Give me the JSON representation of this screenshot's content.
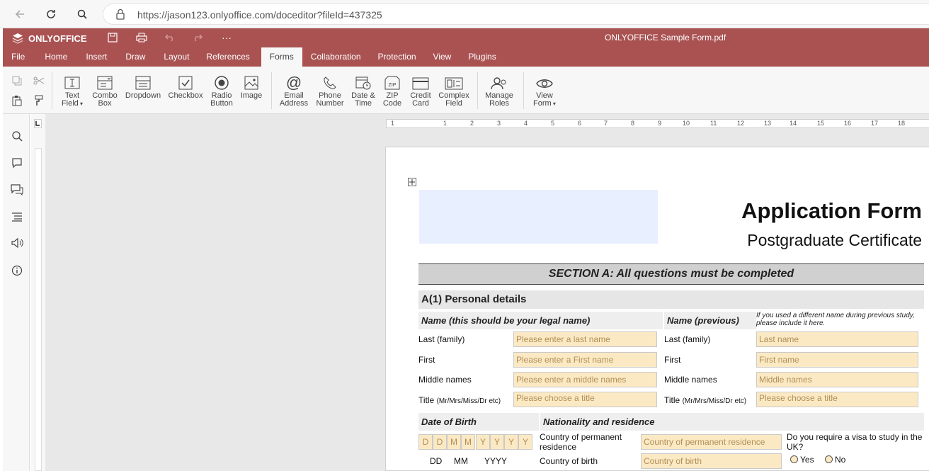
{
  "browser": {
    "url": "https://jason123.onlyoffice.com/doceditor?fileId=437325"
  },
  "app": {
    "logo_text": "ONLYOFFICE",
    "document_title": "ONLYOFFICE Sample Form.pdf",
    "brand_color": "#aa5252"
  },
  "tabs": [
    {
      "label": "File"
    },
    {
      "label": "Home"
    },
    {
      "label": "Insert"
    },
    {
      "label": "Draw"
    },
    {
      "label": "Layout"
    },
    {
      "label": "References"
    },
    {
      "label": "Forms"
    },
    {
      "label": "Collaboration"
    },
    {
      "label": "Protection"
    },
    {
      "label": "View"
    },
    {
      "label": "Plugins"
    }
  ],
  "active_tab": "Forms",
  "toolbar": {
    "text_field": [
      "Text",
      "Field"
    ],
    "combo_box": [
      "Combo",
      "Box"
    ],
    "dropdown": "Dropdown",
    "checkbox": "Checkbox",
    "radio_button": [
      "Radio",
      "Button"
    ],
    "image": "Image",
    "email_address": [
      "Email",
      "Address"
    ],
    "phone_number": [
      "Phone",
      "Number"
    ],
    "date_time": [
      "Date &",
      "Time"
    ],
    "zip_code": [
      "ZIP",
      "Code"
    ],
    "credit_card": [
      "Credit",
      "Card"
    ],
    "complex_field": [
      "Complex",
      "Field"
    ],
    "manage_roles": [
      "Manage",
      "Roles"
    ],
    "view_form": [
      "View",
      "Form"
    ]
  },
  "ruler": [
    "1",
    "1",
    "2",
    "3",
    "4",
    "5",
    "6",
    "7",
    "8",
    "9",
    "10",
    "11",
    "12",
    "13",
    "14",
    "15",
    "16",
    "17",
    "18"
  ],
  "document": {
    "heading": "Application Form",
    "subheading": "Postgraduate Certificate",
    "section_a": "SECTION A: All questions must be completed",
    "section_a1": "A(1) Personal details",
    "name_legal_header": "Name (this should be your legal name)",
    "name_previous_header": "Name (previous)",
    "name_previous_note": "If you used a different name during previous study, please include it here.",
    "left_fields": [
      {
        "label": "Last (family)",
        "placeholder": "Please enter a last name"
      },
      {
        "label": "First",
        "placeholder": "Please enter a First name"
      },
      {
        "label": "Middle names",
        "placeholder": "Please enter a middle names"
      },
      {
        "label": "Title",
        "label_small": "(Mr/Mrs/Miss/Dr etc)",
        "placeholder": "Please choose a title"
      }
    ],
    "right_fields": [
      {
        "label": "Last (family)",
        "placeholder": "Last name"
      },
      {
        "label": "First",
        "placeholder": "First name"
      },
      {
        "label": "Middle names",
        "placeholder": "Middle names"
      },
      {
        "label": "Title",
        "label_small": "(Mr/Mrs/Miss/Dr etc)",
        "placeholder": "Please choose a title"
      }
    ],
    "dob_header": "Date of Birth",
    "dob_cells": [
      "D",
      "D",
      "M",
      "M",
      "Y",
      "Y",
      "Y",
      "Y"
    ],
    "dob_legend": [
      "DD",
      "MM",
      "YYYY"
    ],
    "nationality_header": "Nationality and residence",
    "country_residence_label": "Country of permanent residence",
    "country_residence_placeholder": "Country of permanent residence",
    "country_birth_label": "Country of birth",
    "country_birth_placeholder": "Country of birth",
    "visa_question": "Do you require a visa to study in the UK?",
    "visa_yes": "Yes",
    "visa_no": "No",
    "field_color": "#fbe9c4"
  }
}
